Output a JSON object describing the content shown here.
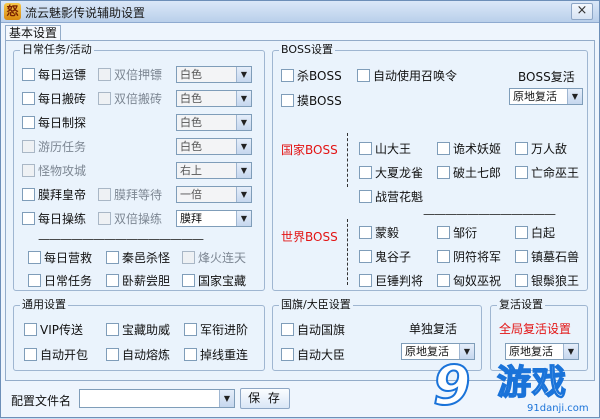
{
  "window": {
    "title_icon_char": "怒",
    "title": "流云魅影传说辅助设置",
    "close": "×"
  },
  "tab": "基本设置",
  "daily": {
    "legend": "日常任务/活动",
    "items": [
      {
        "label": "每日运镖",
        "disabled": false
      },
      {
        "label": "双倍押镖",
        "disabled": true,
        "select": "白色",
        "select_disabled": true
      },
      {
        "label": "每日搬砖",
        "disabled": false
      },
      {
        "label": "双倍搬砖",
        "disabled": true,
        "select": "白色",
        "select_disabled": true
      },
      {
        "label": "每日制探",
        "disabled": false,
        "select": "白色",
        "select_disabled": true
      },
      {
        "label": "游历任务",
        "disabled": true,
        "select": "白色",
        "select_disabled": true
      },
      {
        "label": "怪物攻城",
        "disabled": true,
        "select": "右上",
        "select_disabled": true
      },
      {
        "label": "膜拜皇帝",
        "disabled": false
      },
      {
        "label": "膜拜等待",
        "disabled": true,
        "select": "一倍",
        "select_disabled": true
      },
      {
        "label": "每日操练",
        "disabled": false
      },
      {
        "label": "双倍操练",
        "disabled": true,
        "select": "膜拜",
        "select_disabled": false
      }
    ],
    "separator": "———————————————",
    "extra": [
      {
        "label": "每日营救",
        "disabled": false
      },
      {
        "label": "秦邑杀怪",
        "disabled": false
      },
      {
        "label": "烽火连天",
        "disabled": true
      },
      {
        "label": "日常任务",
        "disabled": false
      },
      {
        "label": "卧薪尝胆",
        "disabled": false
      },
      {
        "label": "国家宝藏",
        "disabled": false
      }
    ]
  },
  "boss": {
    "legend": "BOSS设置",
    "kill": "杀BOSS",
    "auto_summon": "自动使用召唤令",
    "touch": "摸BOSS",
    "revive_label": "BOSS复活",
    "revive_select": "原地复活",
    "national_label": "国家BOSS",
    "world_label": "世界BOSS",
    "national": [
      "山大王",
      "诡术妖姬",
      "万人敌",
      "大夏龙雀",
      "破土七郎",
      "亡命巫王",
      "战营花魁"
    ],
    "world": [
      "蒙毅",
      "邹衍",
      "白起",
      "鬼谷子",
      "阴符将军",
      "镇墓石兽",
      "巨锤判将",
      "匈奴巫祝",
      "银鬃狼王"
    ],
    "separator": "————————————"
  },
  "general": {
    "legend": "通用设置",
    "items": [
      "VIP传送",
      "宝藏助威",
      "军衔进阶",
      "自动开包",
      "自动熔炼",
      "掉线重连"
    ]
  },
  "flag": {
    "legend": "国旗/大臣设置",
    "auto_flag": "自动国旗",
    "auto_minister": "自动大臣",
    "revive_label": "单独复活",
    "revive_select": "原地复活"
  },
  "revive": {
    "legend": "复活设置",
    "global_label": "全局复活设置",
    "select": "原地复活"
  },
  "footer": {
    "config_label": "配置文件名",
    "config_value": "",
    "save_button": "保 存"
  },
  "logo": {
    "mark": "9",
    "name": "游戏",
    "url": "91danji.com"
  },
  "colors": {
    "accent_red": "#e31414",
    "logo_blue": "#1a73d9"
  }
}
